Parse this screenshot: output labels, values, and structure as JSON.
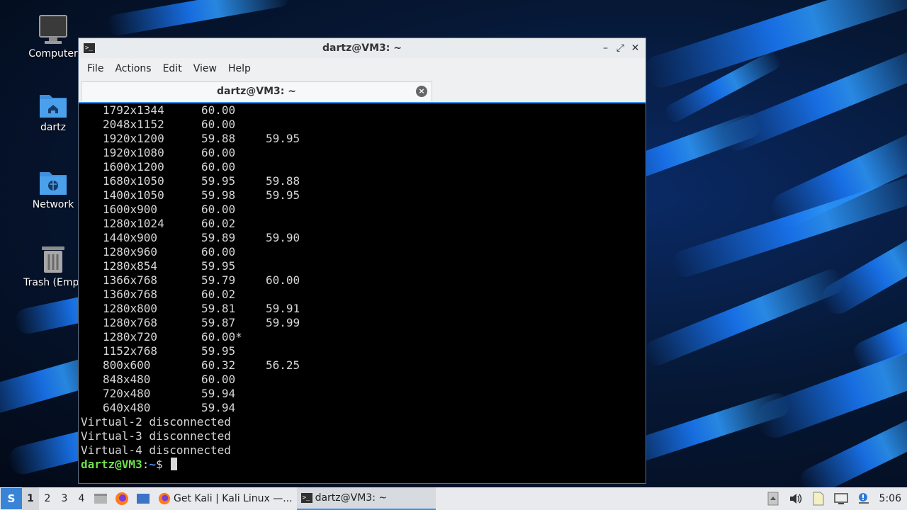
{
  "desktop": {
    "icons": [
      {
        "label": "Computer"
      },
      {
        "label": "dartz"
      },
      {
        "label": "Network"
      },
      {
        "label": "Trash (Empt"
      }
    ]
  },
  "window": {
    "title": "dartz@VM3: ~",
    "controls": {
      "minimize": "–",
      "maximize": "⤢",
      "close": "✕"
    },
    "menu": [
      "File",
      "Actions",
      "Edit",
      "View",
      "Help"
    ],
    "tab": {
      "title": "dartz@VM3: ~",
      "close": "×"
    }
  },
  "terminal": {
    "modes": [
      {
        "res": "1792x1344",
        "r1": "60.00",
        "r2": ""
      },
      {
        "res": "2048x1152",
        "r1": "60.00",
        "r2": ""
      },
      {
        "res": "1920x1200",
        "r1": "59.88",
        "r2": "59.95"
      },
      {
        "res": "1920x1080",
        "r1": "60.00",
        "r2": ""
      },
      {
        "res": "1600x1200",
        "r1": "60.00",
        "r2": ""
      },
      {
        "res": "1680x1050",
        "r1": "59.95",
        "r2": "59.88"
      },
      {
        "res": "1400x1050",
        "r1": "59.98",
        "r2": "59.95"
      },
      {
        "res": "1600x900",
        "r1": "60.00",
        "r2": ""
      },
      {
        "res": "1280x1024",
        "r1": "60.02",
        "r2": ""
      },
      {
        "res": "1440x900",
        "r1": "59.89",
        "r2": "59.90"
      },
      {
        "res": "1280x960",
        "r1": "60.00",
        "r2": ""
      },
      {
        "res": "1280x854",
        "r1": "59.95",
        "r2": ""
      },
      {
        "res": "1366x768",
        "r1": "59.79",
        "r2": "60.00"
      },
      {
        "res": "1360x768",
        "r1": "60.02",
        "r2": ""
      },
      {
        "res": "1280x800",
        "r1": "59.81",
        "r2": "59.91"
      },
      {
        "res": "1280x768",
        "r1": "59.87",
        "r2": "59.99"
      },
      {
        "res": "1280x720",
        "r1": "60.00*",
        "r2": ""
      },
      {
        "res": "1152x768",
        "r1": "59.95",
        "r2": ""
      },
      {
        "res": "800x600",
        "r1": "60.32",
        "r2": "56.25"
      },
      {
        "res": "848x480",
        "r1": "60.00",
        "r2": ""
      },
      {
        "res": "720x480",
        "r1": "59.94",
        "r2": ""
      },
      {
        "res": "640x480",
        "r1": "59.94",
        "r2": ""
      }
    ],
    "status_lines": [
      "Virtual-2 disconnected",
      "Virtual-3 disconnected",
      "Virtual-4 disconnected"
    ],
    "prompt": {
      "user": "dartz@VM3",
      "sep": ":",
      "path": "~",
      "symbol": "$ "
    }
  },
  "taskbar": {
    "menu_icon": "S",
    "workspaces": [
      "1",
      "2",
      "3",
      "4"
    ],
    "active_workspace": 0,
    "tasks": [
      {
        "label": "Get Kali | Kali Linux —..."
      },
      {
        "label": "dartz@VM3: ~"
      }
    ],
    "clock": "5:06"
  }
}
